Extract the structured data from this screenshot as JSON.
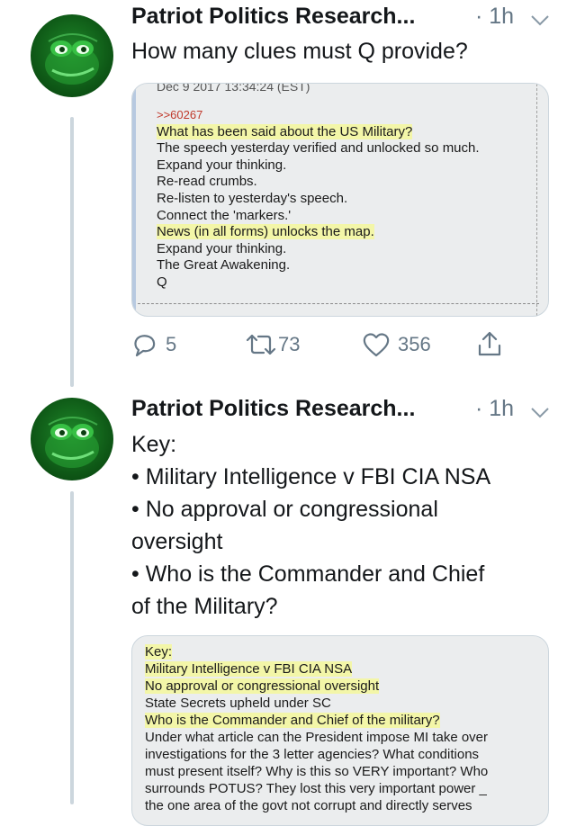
{
  "tweets": [
    {
      "author": "Patriot Politics Research...",
      "time": "· 1h",
      "text_lines": [
        "How many clues must Q provide?"
      ],
      "media": {
        "header": "Dec 9 2017 13:34:24 (EST)",
        "ref": ">>60267",
        "lines": [
          "What has been said about the US Military?",
          "The speech yesterday verified and unlocked so much.",
          "Expand your thinking.",
          "Re-read crumbs.",
          "Re-listen to yesterday's speech.",
          "Connect the 'markers.'",
          "News (in all forms) unlocks the map.",
          "Expand your thinking.",
          "The Great Awakening.",
          "Q"
        ]
      },
      "actions": {
        "replies": "5",
        "retweets": "73",
        "likes": "356"
      }
    },
    {
      "author": "Patriot Politics Research...",
      "time": "· 1h",
      "text_lines": [
        "Key:",
        "• Military Intelligence v FBI CIA NSA",
        "• No approval or congressional",
        "oversight",
        "• Who is the Commander and Chief",
        "of the Military?"
      ],
      "media": {
        "lines": [
          "Key:",
          "Military Intelligence v FBI CIA NSA",
          "No approval or congressional oversight",
          "State Secrets upheld under SC",
          "Who is the Commander and Chief of the military?",
          "Under what article can the President impose MI take over",
          "investigations for the 3 letter agencies? What conditions",
          "must present itself? Why is this so VERY important? Who",
          "surrounds POTUS? They lost this very important power _",
          "the one area of the govt not corrupt and directly serves"
        ]
      }
    }
  ],
  "colors": {
    "text": "#14171a",
    "secondary": "#657786",
    "highlight": "#f3f6a8",
    "thread_line": "#ccd6dd",
    "avatar_green": "#1f8a2a"
  },
  "icons": [
    "reply-icon",
    "retweet-icon",
    "like-icon",
    "share-icon",
    "chevron-down-icon"
  ]
}
